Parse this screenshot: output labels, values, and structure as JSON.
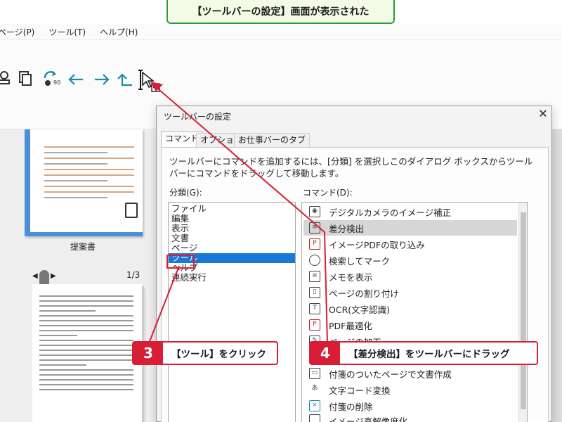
{
  "banner": "【ツールバーの設定】画面が表示された",
  "menubar": {
    "items": [
      "ページ(P)",
      "ツール(T)",
      "ヘルプ(H)"
    ]
  },
  "toolbar": {
    "icons": [
      "stamp-icon",
      "copy-icon",
      "rotate-90-icon",
      "arrow-left-icon",
      "arrow-right-icon",
      "arrow-up-icon",
      "cursor-drag-icon"
    ],
    "rotate_label": "90"
  },
  "thumbs": {
    "label1": "提案書",
    "page_count": "1/3"
  },
  "dialog": {
    "title": "ツールバーの設定",
    "tabs": [
      "コマンド",
      "オプション",
      "お仕事バーのタブ"
    ],
    "instruction": "ツールバーにコマンドを追加するには、[分類] を選択しこのダイアログ ボックスからツール バーにコマンドをドラッグして移動します。",
    "category_label": "分類(G):",
    "command_label": "コマンド(D):",
    "categories": [
      "ファイル",
      "編集",
      "表示",
      "文書",
      "ページ",
      "ツール",
      "ヘルプ",
      "連続実行"
    ],
    "selected_category": "ツール",
    "commands": [
      "デジタルカメラのイメージ補正",
      "差分検出",
      "イメージPDFの取り込み",
      "検索してマーク",
      "メモを表示",
      "ページの割り付け",
      "OCR(文字認識)",
      "PDF最適化",
      "ページの加工",
      "",
      "付箋のついたページで文書作成",
      "文字コード変換",
      "付箋の削除",
      "イメージ高解像度化"
    ],
    "highlighted_command": "差分検出"
  },
  "callouts": [
    {
      "num": "3",
      "text": "【ツール】をクリック"
    },
    {
      "num": "4",
      "text": "【差分検出】をツールバーにドラッグ"
    }
  ],
  "colors": {
    "accent": "#d81e36",
    "banner_border": "#2e9a3c",
    "selection": "#1a78d6",
    "icon_teal": "#1a8caa"
  }
}
